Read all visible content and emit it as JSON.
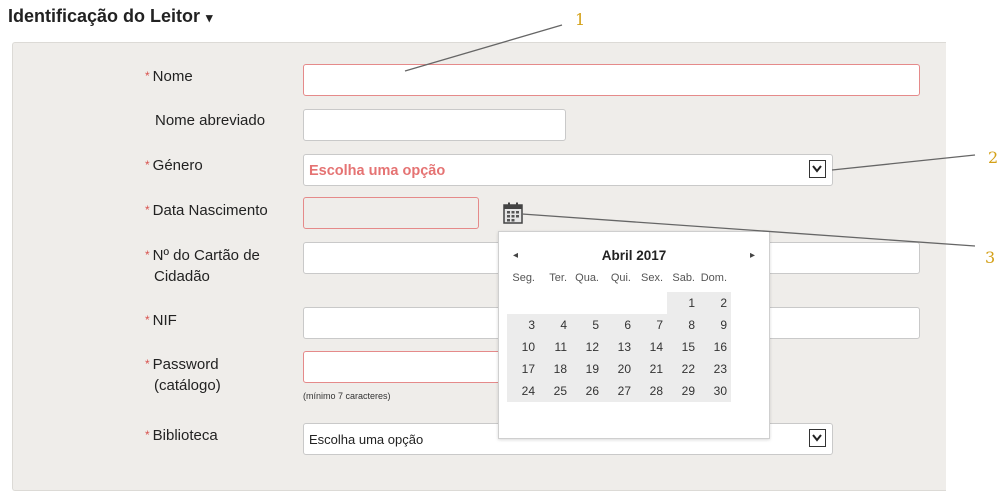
{
  "section": {
    "title": "Identificação do Leitor",
    "caret": "▾"
  },
  "form": {
    "required_mark": "*",
    "name_label": "Nome",
    "short_name_label": "Nome abreviado",
    "gender_label": "Género",
    "gender_value": "Escolha uma opção",
    "birthdate_label": "Data Nascimento",
    "citizen_card_label_1": "Nº do Cartão de",
    "citizen_card_label_2": "Cidadão",
    "nif_label": "NIF",
    "password_label_1": "Password",
    "password_label_2": "(catálogo)",
    "password_hint": "(mínimo 7 caracteres)",
    "library_label": "Biblioteca",
    "library_value": "Escolha uma opção"
  },
  "calendar": {
    "prev": "◂",
    "next": "▸",
    "month": "Abril",
    "year": "2017",
    "weekdays": [
      "Seg.",
      "Ter.",
      "Qua.",
      "Qui.",
      "Sex.",
      "Sab.",
      "Dom."
    ],
    "weeks": [
      [
        "",
        "",
        "",
        "",
        "",
        "1",
        "2"
      ],
      [
        "3",
        "4",
        "5",
        "6",
        "7",
        "8",
        "9"
      ],
      [
        "10",
        "11",
        "12",
        "13",
        "14",
        "15",
        "16"
      ],
      [
        "17",
        "18",
        "19",
        "20",
        "21",
        "22",
        "23"
      ],
      [
        "24",
        "25",
        "26",
        "27",
        "28",
        "29",
        "30"
      ]
    ]
  },
  "annotations": {
    "a1": "1",
    "a2": "2",
    "a3": "3"
  },
  "colors": {
    "required": "#d9534f",
    "error_border": "#e58a8a",
    "annotation": "#d4a017",
    "panel_bg": "#efedea"
  }
}
